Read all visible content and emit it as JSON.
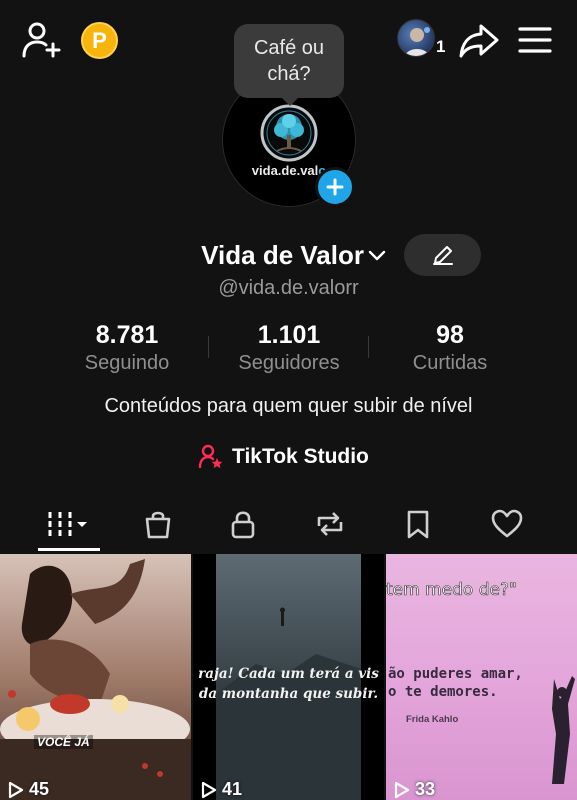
{
  "header": {
    "coin_label": "P",
    "avatar_count": "1",
    "icons": [
      "add-friend-icon",
      "coin-icon",
      "share-icon",
      "menu-icon"
    ]
  },
  "profile": {
    "bubble_text": "Café ou chá?",
    "logo_text_prefix": "vida.de.val",
    "logo_text_suffix": "o",
    "display_name": "Vida de Valor",
    "username": "@vida.de.valorr",
    "bio": "Conteúdos para quem quer subir de nível"
  },
  "stats": {
    "following": {
      "value": "8.781",
      "label": "Seguindo"
    },
    "followers": {
      "value": "1.101",
      "label": "Seguidores"
    },
    "likes": {
      "value": "98",
      "label": "Curtidas"
    }
  },
  "studio": {
    "label": "TikTok Studio",
    "accent": "#fe2c55"
  },
  "tabs": [
    "videos",
    "shop",
    "private",
    "reposts",
    "favorites",
    "liked"
  ],
  "videos": [
    {
      "views": "45",
      "tag": "VOCÊ JÁ"
    },
    {
      "views": "41",
      "caption_line1": "raja! Cada um terá a vis",
      "caption_line2": "da montanha que subir."
    },
    {
      "views": "33",
      "top_text": "tem medo de?\"",
      "quote_line1": "ão puderes amar,",
      "quote_line2": "o te demores.",
      "author": "Frida Kahlo"
    }
  ],
  "colors": {
    "background": "#121212",
    "accent_blue": "#20a6e8",
    "coin": "#f5b50c"
  }
}
